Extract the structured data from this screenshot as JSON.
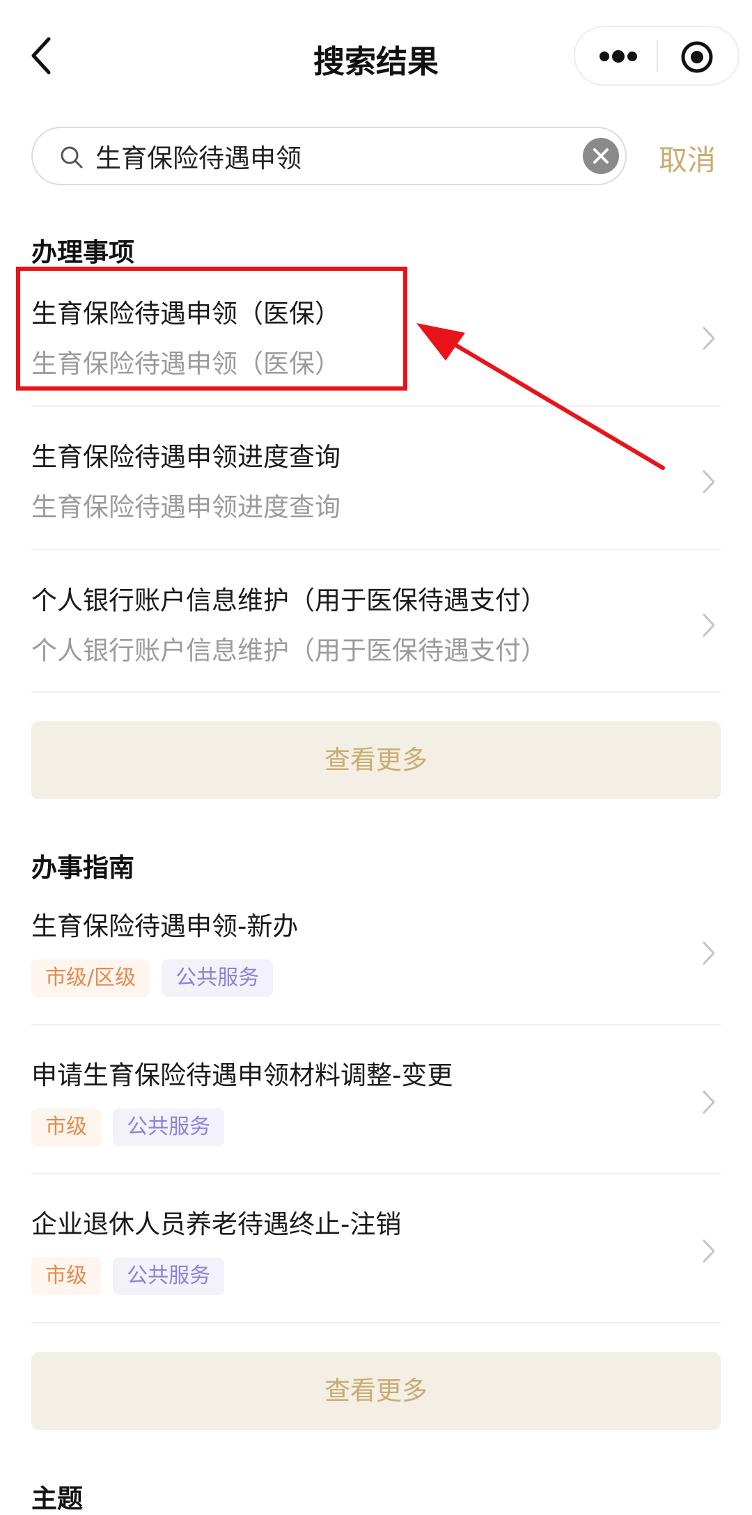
{
  "nav": {
    "title": "搜索结果"
  },
  "search": {
    "value": "生育保险待遇申领",
    "cancel_label": "取消"
  },
  "sections": {
    "matters": {
      "title": "办理事项",
      "items": [
        {
          "title": "生育保险待遇申领（医保）",
          "subtitle": "生育保险待遇申领（医保）"
        },
        {
          "title": "生育保险待遇申领进度查询",
          "subtitle": "生育保险待遇申领进度查询"
        },
        {
          "title": "个人银行账户信息维护（用于医保待遇支付）",
          "subtitle": "个人银行账户信息维护（用于医保待遇支付）"
        }
      ],
      "more_label": "查看更多"
    },
    "guides": {
      "title": "办事指南",
      "items": [
        {
          "title": "生育保险待遇申领-新办",
          "tags": [
            "市级/区级",
            "公共服务"
          ]
        },
        {
          "title": "申请生育保险待遇申领材料调整-变更",
          "tags": [
            "市级",
            "公共服务"
          ]
        },
        {
          "title": "企业退休人员养老待遇终止-注销",
          "tags": [
            "市级",
            "公共服务"
          ]
        }
      ],
      "more_label": "查看更多"
    },
    "topics": {
      "title": "主题"
    }
  },
  "colors": {
    "accent": "#c9ac72",
    "more_bg": "#f3efe4",
    "tag_level": "#e58a4c",
    "tag_service": "#8c82d8",
    "annotation_red": "#e8141a"
  },
  "icons": {
    "back": "chevron-left-icon",
    "more": "more-dots-icon",
    "close": "target-circle-icon",
    "search": "search-icon",
    "clear": "clear-icon",
    "row": "chevron-right-icon"
  }
}
